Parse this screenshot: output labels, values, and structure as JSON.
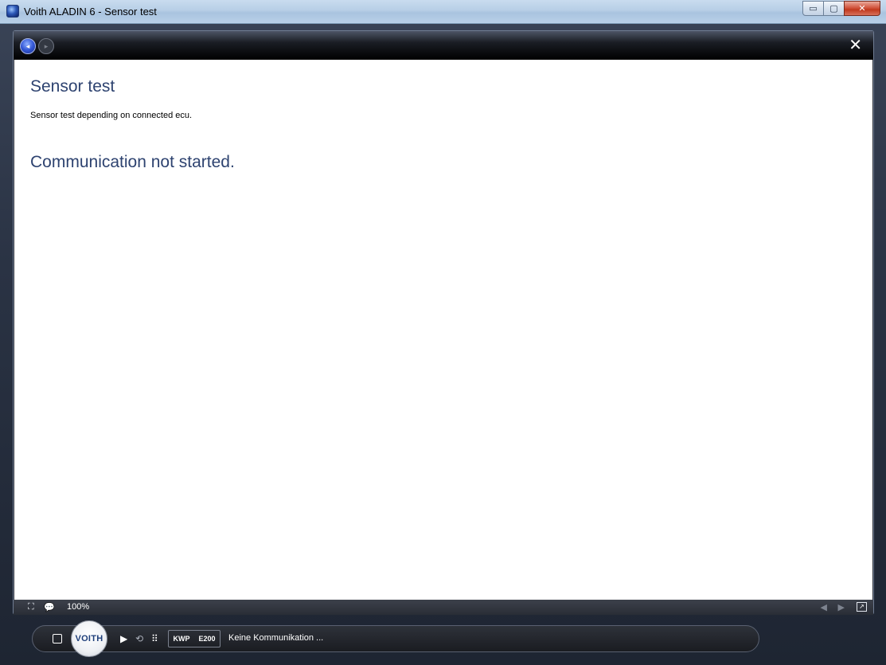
{
  "window": {
    "title": "Voith ALADIN 6 - Sensor test",
    "controls": {
      "minimize": "▭",
      "maximize": "▢",
      "close": "✕"
    }
  },
  "navbar": {
    "back_icon": "◂",
    "forward_icon": "▸",
    "close_icon": "✕"
  },
  "content": {
    "title": "Sensor test",
    "description": "Sensor test depending on connected ecu.",
    "status_message": "Communication not started."
  },
  "statusbar": {
    "zoom": "100%",
    "icons": {
      "fit": "⛶",
      "comment": "💬",
      "prev": "◀",
      "next": "▶",
      "expand": "↗"
    }
  },
  "dock": {
    "logo_text": "VOITH",
    "protocol": "KWP",
    "ecu": "E200",
    "status_text": "Keine Kommunikation ...",
    "icons": {
      "play": "▶",
      "loop": "⟲",
      "grid": "⠿"
    }
  }
}
